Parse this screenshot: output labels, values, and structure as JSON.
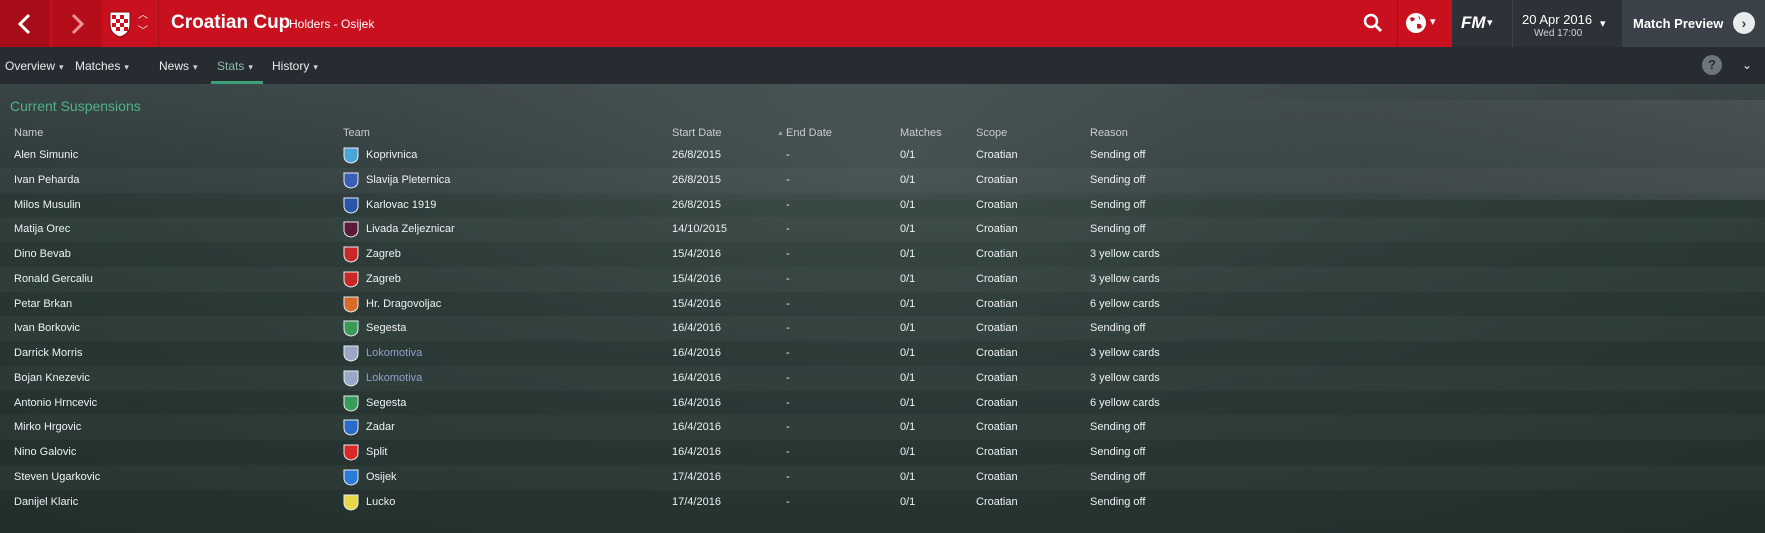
{
  "topbar": {
    "title": "Croatian Cup",
    "subtitle": "Holders - Osijek",
    "fm_logo": "FM",
    "date": "20 Apr 2016",
    "day_time": "Wed 17:00",
    "continue_label": "Match Preview",
    "brand_color": "#c8101e"
  },
  "tabs": [
    {
      "label": "Overview",
      "active": false
    },
    {
      "label": "Matches",
      "active": false
    },
    {
      "label": "News",
      "active": false
    },
    {
      "label": "Stats",
      "active": true
    },
    {
      "label": "History",
      "active": false
    }
  ],
  "panel": {
    "title": "Current Suspensions",
    "columns": [
      "Name",
      "Team",
      "Start Date",
      "End Date",
      "Matches",
      "Scope",
      "Reason"
    ],
    "sorted_column": "End Date"
  },
  "rows": [
    {
      "name": "Alen Simunic",
      "team": "Koprivnica",
      "start": "26/8/2015",
      "end": "-",
      "matches": "0/1",
      "scope": "Croatian",
      "reason": "Sending off",
      "crest_color": "#4aa6d8"
    },
    {
      "name": "Ivan Peharda",
      "team": "Slavija Pleternica",
      "start": "26/8/2015",
      "end": "-",
      "matches": "0/1",
      "scope": "Croatian",
      "reason": "Sending off",
      "crest_color": "#3b5fb8"
    },
    {
      "name": "Milos Musulin",
      "team": "Karlovac 1919",
      "start": "26/8/2015",
      "end": "-",
      "matches": "0/1",
      "scope": "Croatian",
      "reason": "Sending off",
      "crest_color": "#2a56a8"
    },
    {
      "name": "Matija Orec",
      "team": "Livada Zeljeznicar",
      "start": "14/10/2015",
      "end": "-",
      "matches": "0/1",
      "scope": "Croatian",
      "reason": "Sending off",
      "crest_color": "#5a1a3a"
    },
    {
      "name": "Dino Bevab",
      "team": "Zagreb",
      "start": "15/4/2016",
      "end": "-",
      "matches": "0/1",
      "scope": "Croatian",
      "reason": "3 yellow cards",
      "crest_color": "#c82828"
    },
    {
      "name": "Ronald Gercaliu",
      "team": "Zagreb",
      "start": "15/4/2016",
      "end": "-",
      "matches": "0/1",
      "scope": "Croatian",
      "reason": "3 yellow cards",
      "crest_color": "#c82828"
    },
    {
      "name": "Petar Brkan",
      "team": "Hr. Dragovoljac",
      "start": "15/4/2016",
      "end": "-",
      "matches": "0/1",
      "scope": "Croatian",
      "reason": "6 yellow cards",
      "crest_color": "#d86a2a"
    },
    {
      "name": "Ivan Borkovic",
      "team": "Segesta",
      "start": "16/4/2016",
      "end": "-",
      "matches": "0/1",
      "scope": "Croatian",
      "reason": "Sending off",
      "crest_color": "#3a9a5a"
    },
    {
      "name": "Darrick Morris",
      "team": "Lokomotiva",
      "start": "16/4/2016",
      "end": "-",
      "matches": "0/1",
      "scope": "Croatian",
      "reason": "3 yellow cards",
      "crest_color": "#9aa8c8",
      "team_link": true
    },
    {
      "name": "Bojan Knezevic",
      "team": "Lokomotiva",
      "start": "16/4/2016",
      "end": "-",
      "matches": "0/1",
      "scope": "Croatian",
      "reason": "3 yellow cards",
      "crest_color": "#9aa8c8",
      "team_link": true
    },
    {
      "name": "Antonio Hrncevic",
      "team": "Segesta",
      "start": "16/4/2016",
      "end": "-",
      "matches": "0/1",
      "scope": "Croatian",
      "reason": "6 yellow cards",
      "crest_color": "#3a9a5a"
    },
    {
      "name": "Mirko Hrgovic",
      "team": "Zadar",
      "start": "16/4/2016",
      "end": "-",
      "matches": "0/1",
      "scope": "Croatian",
      "reason": "Sending off",
      "crest_color": "#2a6ac8"
    },
    {
      "name": "Nino Galovic",
      "team": "Split",
      "start": "16/4/2016",
      "end": "-",
      "matches": "0/1",
      "scope": "Croatian",
      "reason": "Sending off",
      "crest_color": "#d82a2a"
    },
    {
      "name": "Steven Ugarkovic",
      "team": "Osijek",
      "start": "17/4/2016",
      "end": "-",
      "matches": "0/1",
      "scope": "Croatian",
      "reason": "Sending off",
      "crest_color": "#2a7ad8"
    },
    {
      "name": "Danijel Klaric",
      "team": "Lucko",
      "start": "17/4/2016",
      "end": "-",
      "matches": "0/1",
      "scope": "Croatian",
      "reason": "Sending off",
      "crest_color": "#e8d84a"
    }
  ]
}
